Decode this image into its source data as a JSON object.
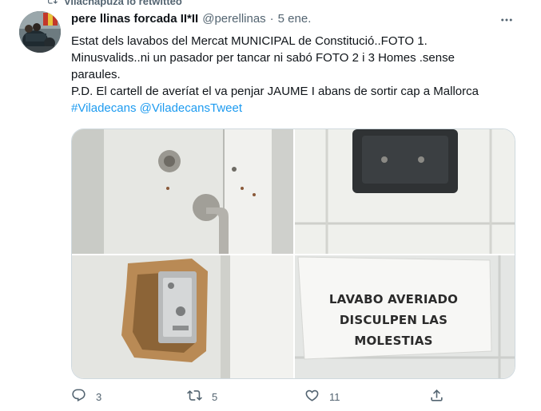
{
  "retweet_context": "Vilachapuza lo retwitteó",
  "tweet": {
    "author_name": "pere llinas forcada II*II",
    "handle": "@perellinas",
    "date": "5 ene.",
    "text_lines": [
      "Estat dels lavabos del Mercat MUNICIPAL de Constitució..FOTO 1.",
      "Minusvalids..ni un pasador per tancar ni sabó FOTO 2 i 3 Homes .sense",
      "paraules.",
      "P.D. El cartell de averíat el va penjar JAUME I abans de sortir cap a Mallorca"
    ],
    "hashtags": [
      "#Viladecans",
      "@ViladecansTweet"
    ],
    "sign_lines": [
      "LAVABO AVERIADO",
      "DISCULPEN LAS",
      "MOLESTIAS"
    ],
    "reply_count": "3",
    "retweet_count": "5",
    "like_count": "11"
  },
  "icons": {
    "retweet_context": "retweet-icon",
    "more": "more-icon",
    "reply": "reply-icon",
    "retweet": "retweet-icon",
    "like": "heart-icon",
    "share": "share-icon"
  },
  "colors": {
    "link": "#1d9bf0",
    "secondary_text": "#536471",
    "primary_text": "#0f1419"
  }
}
